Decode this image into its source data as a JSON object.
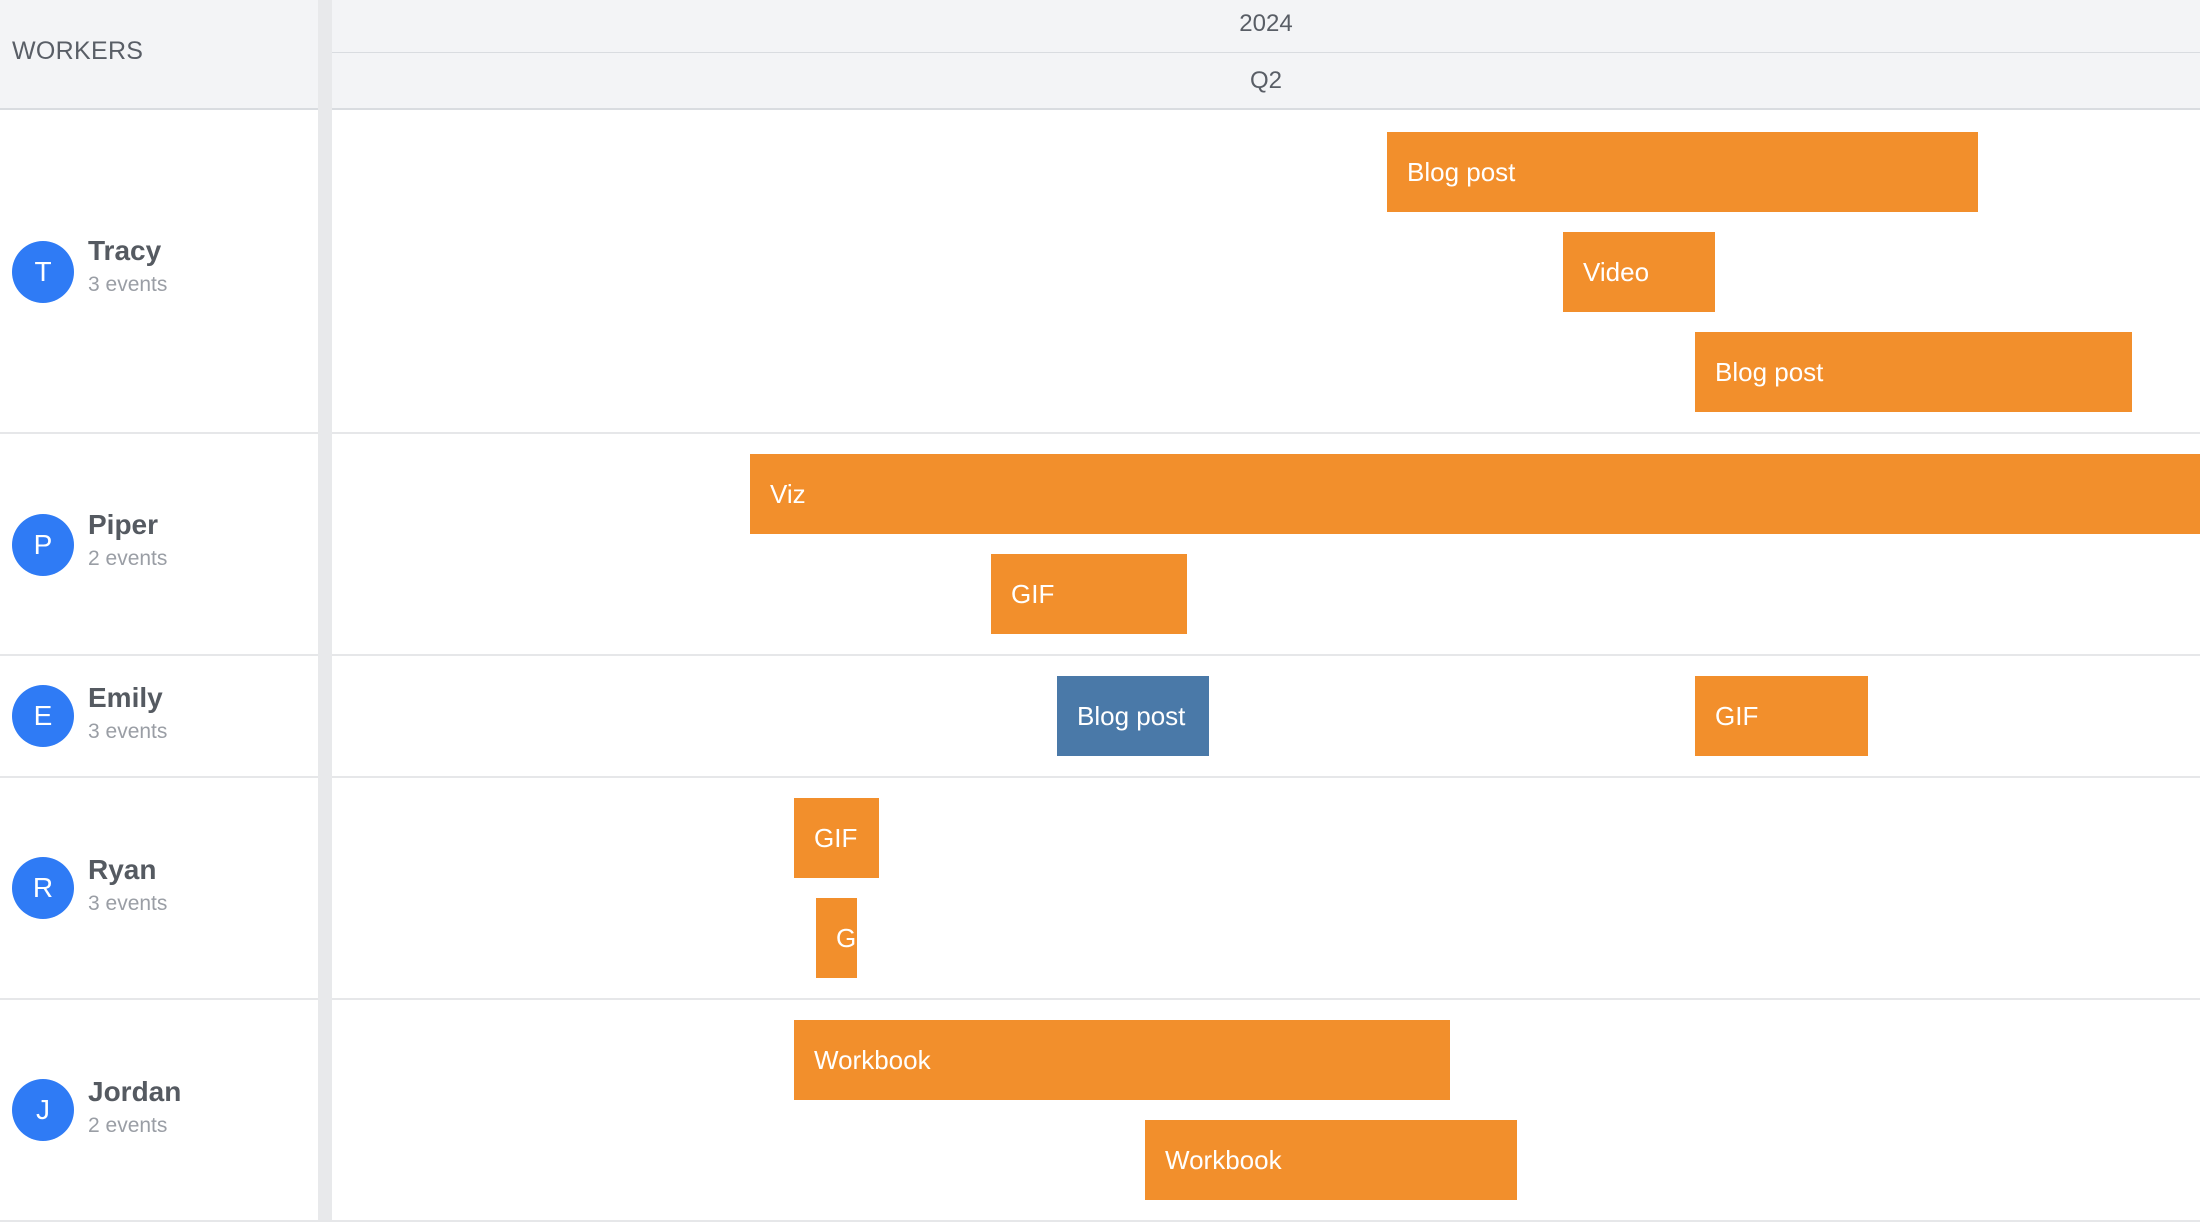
{
  "workers_panel": {
    "title": "WORKERS"
  },
  "timeline": {
    "year": "2024",
    "quarter": "Q2"
  },
  "workers": [
    {
      "initial": "T",
      "name": "Tracy",
      "count": "3 events",
      "events": [
        {
          "label": "Blog post"
        },
        {
          "label": "Video"
        },
        {
          "label": "Blog post"
        }
      ]
    },
    {
      "initial": "P",
      "name": "Piper",
      "count": "2 events",
      "events": [
        {
          "label": "Viz"
        },
        {
          "label": "GIF"
        }
      ]
    },
    {
      "initial": "E",
      "name": "Emily",
      "count": "3 events",
      "events": [
        {
          "label": "Blog post"
        },
        {
          "label": "GIF"
        }
      ]
    },
    {
      "initial": "R",
      "name": "Ryan",
      "count": "3 events",
      "events": [
        {
          "label": "GIF"
        },
        {
          "label": "G"
        }
      ]
    },
    {
      "initial": "J",
      "name": "Jordan",
      "count": "2 events",
      "events": [
        {
          "label": "Workbook"
        },
        {
          "label": "Workbook"
        }
      ]
    }
  ],
  "colors": {
    "event_default": "#f28f2c",
    "event_selected": "#4a79a8",
    "avatar": "#2f7bf5"
  }
}
